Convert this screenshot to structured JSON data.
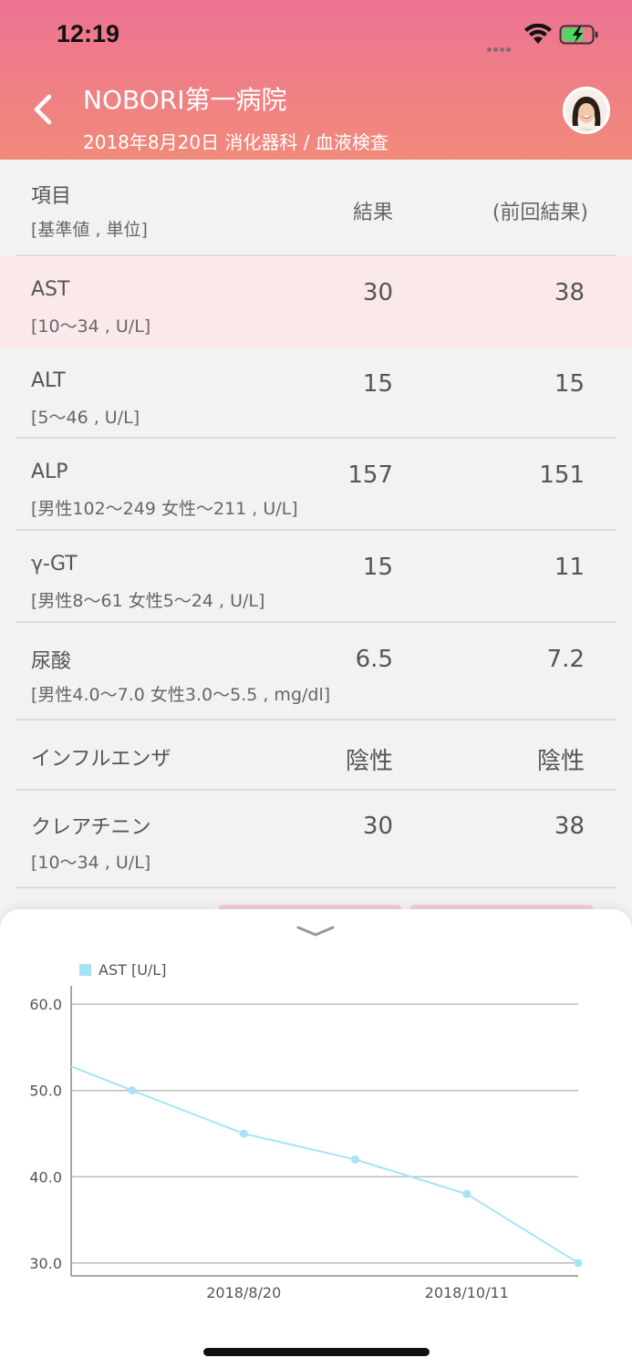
{
  "status_bar": {
    "time": "12:19"
  },
  "header": {
    "hospital": "NOBORI第一病院",
    "visit": "2018年8月20日 消化器科 / 血液検査"
  },
  "table_header": {
    "item": "項目",
    "range": "[基準値 , 単位]",
    "result": "結果",
    "previous": "(前回結果)"
  },
  "rows": [
    {
      "name": "AST",
      "range": "[10〜34 , U/L]",
      "result": "30",
      "previous": "38"
    },
    {
      "name": "ALT",
      "range": "[5〜46 , U/L]",
      "result": "15",
      "previous": "15"
    },
    {
      "name": "ALP",
      "range": "[男性102〜249 女性〜211 , U/L]",
      "result": "157",
      "previous": "151"
    },
    {
      "name": "γ-GT",
      "range": "[男性8〜61 女性5〜24 , U/L]",
      "result": "15",
      "previous": "11"
    },
    {
      "name": "尿酸",
      "range": "[男性4.0〜7.0 女性3.0〜5.5 , mg/dl]",
      "result": "6.5",
      "previous": "7.2"
    },
    {
      "name": "インフルエンザ",
      "range": "",
      "result": "陰性",
      "previous": "陰性"
    },
    {
      "name": "クレアチニン",
      "range": "[10〜34 , U/L]",
      "result": "30",
      "previous": "38"
    }
  ],
  "chart_data": {
    "type": "line",
    "series": [
      {
        "name": "AST [U/L]",
        "color": "#a8e3f5",
        "x": [
          "",
          "",
          "2018/8/20",
          "",
          "2018/10/11",
          ""
        ],
        "values": [
          52.8,
          50.0,
          45.0,
          42.0,
          38.0,
          30.0
        ]
      }
    ],
    "x_tick_labels": [
      "2018/8/20",
      "2018/10/11"
    ],
    "y_ticks": [
      "60.0",
      "50.0",
      "40.0",
      "30.0"
    ],
    "ylim": [
      28.5,
      61.5
    ],
    "grid": true,
    "legend": "top-left"
  },
  "colors": {
    "header_top": "#ee7393",
    "header_bottom": "#f08a7a",
    "highlight_row": "#fbe8eb",
    "line": "#a8e3f5"
  }
}
